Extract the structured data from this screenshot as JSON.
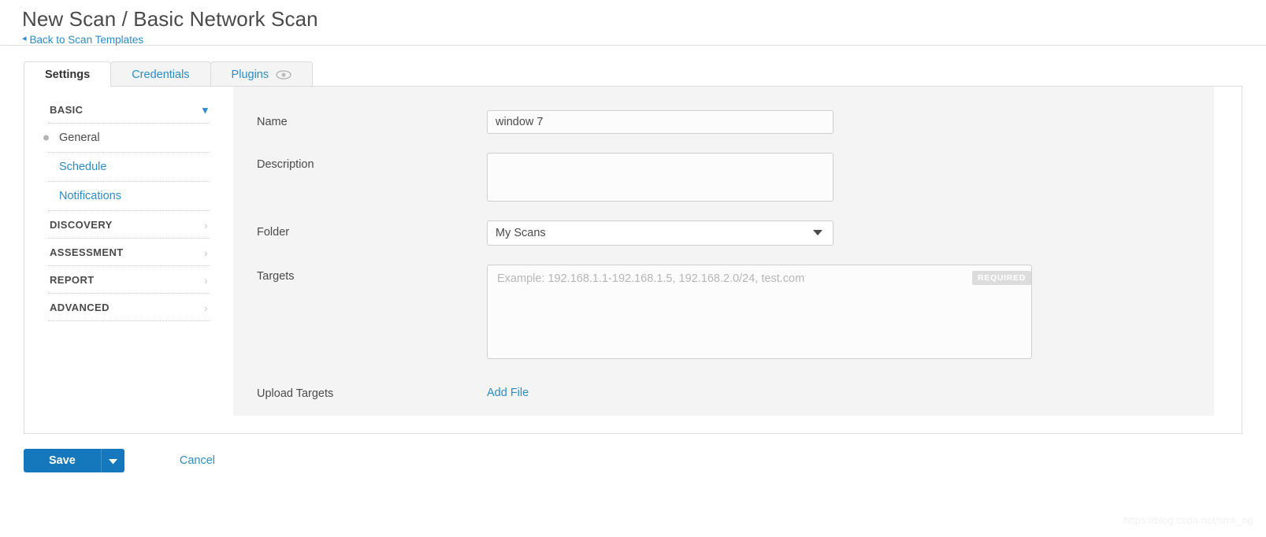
{
  "header": {
    "title": "New Scan / Basic Network Scan",
    "back_link": "Back to Scan Templates",
    "back_chevron": "chevron-left-icon"
  },
  "tabs": [
    {
      "label": "Settings",
      "active": true
    },
    {
      "label": "Credentials",
      "active": false
    },
    {
      "label": "Plugins",
      "active": false,
      "icon": "eye-icon"
    }
  ],
  "sidebar": {
    "sections": [
      {
        "label": "BASIC",
        "expanded": true,
        "chevron": "chevron-down-icon",
        "items": [
          {
            "label": "General",
            "active": true
          },
          {
            "label": "Schedule",
            "active": false
          },
          {
            "label": "Notifications",
            "active": false
          }
        ]
      },
      {
        "label": "DISCOVERY",
        "expanded": false,
        "chevron": "chevron-right-icon",
        "items": []
      },
      {
        "label": "ASSESSMENT",
        "expanded": false,
        "chevron": "chevron-right-icon",
        "items": []
      },
      {
        "label": "REPORT",
        "expanded": false,
        "chevron": "chevron-right-icon",
        "items": []
      },
      {
        "label": "ADVANCED",
        "expanded": false,
        "chevron": "chevron-right-icon",
        "items": []
      }
    ]
  },
  "form": {
    "name": {
      "label": "Name",
      "value": "window 7",
      "placeholder": ""
    },
    "description": {
      "label": "Description",
      "value": "",
      "placeholder": ""
    },
    "folder": {
      "label": "Folder",
      "value": "My Scans",
      "options": [
        "My Scans"
      ],
      "arrow_icon": "caret-down-icon"
    },
    "targets": {
      "label": "Targets",
      "value": "",
      "placeholder": "Example: 192.168.1.1-192.168.1.5, 192.168.2.0/24, test.com",
      "required_badge": "REQUIRED"
    },
    "upload_targets": {
      "label": "Upload Targets",
      "link_label": "Add File"
    }
  },
  "footer": {
    "save_label": "Save",
    "save_caret_icon": "caret-down-icon",
    "cancel_label": "Cancel"
  },
  "watermark": "https://blog.csdn.net/smli_ng",
  "colors": {
    "link_blue": "#2b8ccc",
    "button_blue": "#1578bd",
    "panel_bg": "#f4f4f4",
    "border_gray": "#dcdcdc"
  }
}
